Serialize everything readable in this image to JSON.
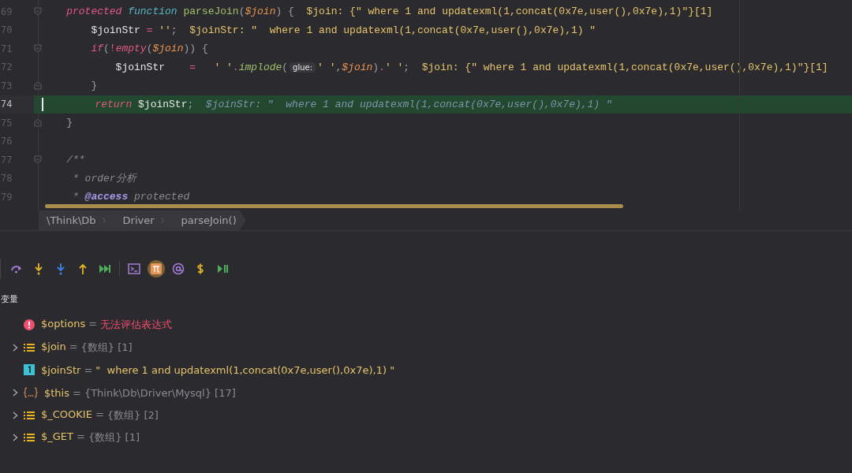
{
  "editor": {
    "lines": [
      {
        "number": "69",
        "current": false,
        "fold_start": true,
        "fold_end": false,
        "tokens": [
          {
            "kind": "keyword",
            "text": "    protected "
          },
          {
            "kind": "decl",
            "text": "function "
          },
          {
            "kind": "fn",
            "text": "parseJoin"
          },
          {
            "kind": "punct",
            "text": "("
          },
          {
            "kind": "var",
            "text": "$join"
          },
          {
            "kind": "punct",
            "text": ") {  "
          },
          {
            "kind": "value",
            "text": "$join: {\" where 1 and updatexml(1,concat(0x7e,user(),0x7e),1)\"}[1]"
          }
        ]
      },
      {
        "number": "70",
        "current": false,
        "fold_start": false,
        "fold_end": false,
        "tokens": [
          {
            "kind": "plain",
            "text": "        $joinStr "
          },
          {
            "kind": "op",
            "text": "= "
          },
          {
            "kind": "str",
            "text": "''"
          },
          {
            "kind": "punct",
            "text": ";  "
          },
          {
            "kind": "value",
            "text": "$joinStr: \"  where 1 and updatexml(1,concat(0x7e,user(),0x7e),1) \""
          }
        ]
      },
      {
        "number": "71",
        "current": false,
        "fold_start": true,
        "fold_end": false,
        "tokens": [
          {
            "kind": "keyword",
            "text": "        if"
          },
          {
            "kind": "punct",
            "text": "("
          },
          {
            "kind": "op",
            "text": "!"
          },
          {
            "kind": "keyword",
            "text": "empty"
          },
          {
            "kind": "punct",
            "text": "("
          },
          {
            "kind": "var",
            "text": "$join"
          },
          {
            "kind": "punct",
            "text": ")) {"
          }
        ]
      },
      {
        "number": "72",
        "current": false,
        "fold_start": false,
        "fold_end": false,
        "tokens": [
          {
            "kind": "plain",
            "text": "            $joinStr    "
          },
          {
            "kind": "op",
            "text": "=   "
          },
          {
            "kind": "str",
            "text": "' '"
          },
          {
            "kind": "op",
            "text": "."
          },
          {
            "kind": "fnitalic",
            "text": "implode"
          },
          {
            "kind": "punct",
            "text": "("
          },
          {
            "kind": "hint",
            "text": "glue:"
          },
          {
            "kind": "str",
            "text": "' '"
          },
          {
            "kind": "punct",
            "text": ","
          },
          {
            "kind": "var",
            "text": "$join"
          },
          {
            "kind": "punct",
            "text": ")"
          },
          {
            "kind": "op",
            "text": "."
          },
          {
            "kind": "str",
            "text": "' '"
          },
          {
            "kind": "punct",
            "text": ";  "
          },
          {
            "kind": "value",
            "text": "$join: {\" where 1 and updatexml(1,concat(0x7e,user(),0x7e),1)\"}[1]"
          }
        ]
      },
      {
        "number": "73",
        "current": false,
        "fold_start": false,
        "fold_end": true,
        "tokens": [
          {
            "kind": "punct",
            "text": "        }"
          }
        ]
      },
      {
        "number": "74",
        "current": true,
        "fold_start": false,
        "fold_end": false,
        "tokens": [
          {
            "kind": "keyword",
            "text": "        return "
          },
          {
            "kind": "plain",
            "text": "$joinStr"
          },
          {
            "kind": "punct",
            "text": ";  "
          },
          {
            "kind": "currentvalue",
            "text": "$joinStr: \"  where 1 and updatexml(1,concat(0x7e,user(),0x7e),1) \""
          }
        ]
      },
      {
        "number": "75",
        "current": false,
        "fold_start": false,
        "fold_end": true,
        "tokens": [
          {
            "kind": "punct",
            "text": "    }"
          }
        ]
      },
      {
        "number": "76",
        "current": false,
        "fold_start": false,
        "fold_end": false
      },
      {
        "number": "77",
        "current": false,
        "fold_start": true,
        "fold_end": false,
        "tokens": [
          {
            "kind": "comment",
            "text": "    /**"
          }
        ]
      },
      {
        "number": "78",
        "current": false,
        "fold_start": false,
        "fold_end": false,
        "tokens": [
          {
            "kind": "comment",
            "text": "     * order分析"
          }
        ]
      },
      {
        "number": "79",
        "current": false,
        "fold_start": false,
        "fold_end": false,
        "tokens": [
          {
            "kind": "comment",
            "text": "     * "
          },
          {
            "kind": "doctag",
            "text": "@access"
          },
          {
            "kind": "comment",
            "text": " protected"
          }
        ]
      }
    ]
  },
  "breadcrumbs": [
    "\\Think\\Db",
    "Driver",
    "parseJoin()"
  ],
  "debug_toolbar": [
    {
      "kind": "step-over",
      "selected": false
    },
    {
      "kind": "step-into",
      "selected": false
    },
    {
      "kind": "force-step-into",
      "selected": false
    },
    {
      "kind": "step-out",
      "selected": false
    },
    {
      "kind": "run-to-cursor",
      "selected": false
    },
    {
      "kind": "evaluate",
      "selected": false
    },
    {
      "kind": "pi",
      "selected": true
    },
    {
      "kind": "at",
      "selected": false
    },
    {
      "kind": "dollar",
      "selected": false
    },
    {
      "kind": "resume",
      "selected": false
    }
  ],
  "variables": {
    "title": "变量",
    "items": [
      {
        "kind": "error",
        "expandable": false,
        "name": "$options",
        "equals": "=",
        "value": "无法评估表达式"
      },
      {
        "kind": "array",
        "expandable": true,
        "name": "$join",
        "equals": "=",
        "value": "{数组} [1]"
      },
      {
        "kind": "scalar",
        "expandable": false,
        "name": "$joinStr",
        "equals": "=",
        "value": "\"  where 1 and updatexml(1,concat(0x7e,user(),0x7e),1) \""
      },
      {
        "kind": "object",
        "expandable": true,
        "name": "$this",
        "equals": "=",
        "value": "{Think\\Db\\Driver\\Mysql} [17]"
      },
      {
        "kind": "array",
        "expandable": true,
        "name": "$_COOKIE",
        "equals": "=",
        "value": "{数组} [2]"
      },
      {
        "kind": "array",
        "expandable": true,
        "name": "$_GET",
        "equals": "=",
        "value": "{数组} [1]"
      }
    ]
  }
}
